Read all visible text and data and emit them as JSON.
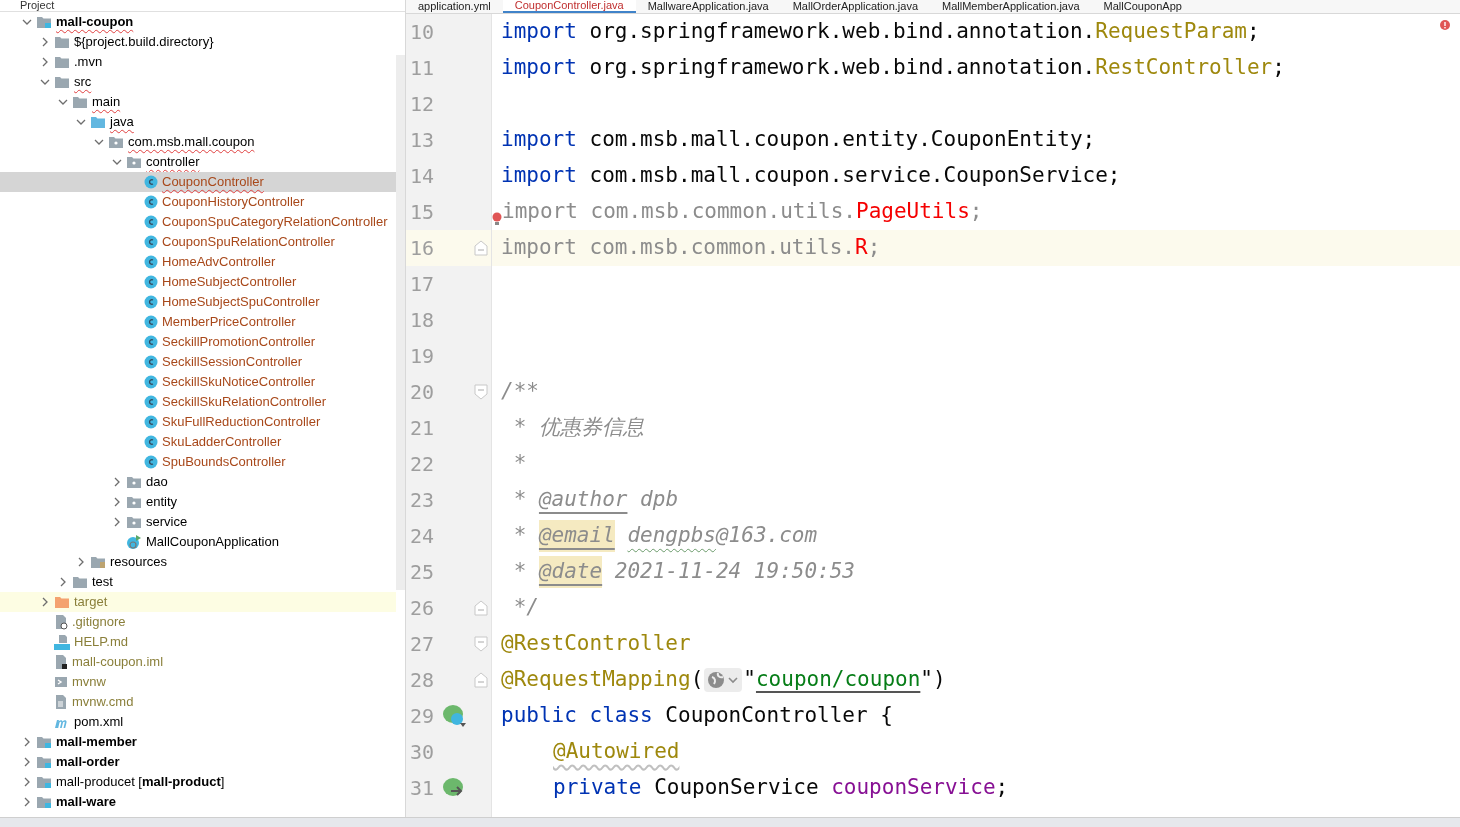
{
  "project_panel": {
    "title": "Project",
    "tree": [
      {
        "label": "mall-coupon",
        "kind": "module",
        "bold": true,
        "error": true,
        "expanded": true,
        "children": [
          {
            "label": "${project.build.directory}",
            "kind": "folder",
            "expanded": false
          },
          {
            "label": ".mvn",
            "kind": "folder",
            "expanded": false
          },
          {
            "label": "src",
            "kind": "folder",
            "error": true,
            "expanded": true,
            "children": [
              {
                "label": "main",
                "kind": "folder",
                "error": true,
                "expanded": true,
                "children": [
                  {
                    "label": "java",
                    "kind": "source-folder",
                    "error": true,
                    "expanded": true,
                    "children": [
                      {
                        "label": "com.msb.mall.coupon",
                        "kind": "package",
                        "error": true,
                        "expanded": true,
                        "children": [
                          {
                            "label": "controller",
                            "kind": "package",
                            "error": true,
                            "expanded": true,
                            "children": [
                              {
                                "label": "CouponController",
                                "kind": "class",
                                "color": "#a8481a",
                                "error": true,
                                "selected": true
                              },
                              {
                                "label": "CouponHistoryController",
                                "kind": "class",
                                "color": "#a8481a",
                                "selected": false
                              },
                              {
                                "label": "CouponSpuCategoryRelationController",
                                "kind": "class",
                                "color": "#a8481a",
                                "selected": false
                              },
                              {
                                "label": "CouponSpuRelationController",
                                "kind": "class",
                                "color": "#a8481a",
                                "selected": false
                              },
                              {
                                "label": "HomeAdvController",
                                "kind": "class",
                                "color": "#a8481a",
                                "selected": false
                              },
                              {
                                "label": "HomeSubjectController",
                                "kind": "class",
                                "color": "#a8481a",
                                "selected": false
                              },
                              {
                                "label": "HomeSubjectSpuController",
                                "kind": "class",
                                "color": "#a8481a",
                                "selected": false
                              },
                              {
                                "label": "MemberPriceController",
                                "kind": "class",
                                "color": "#a8481a",
                                "selected": false
                              },
                              {
                                "label": "SeckillPromotionController",
                                "kind": "class",
                                "color": "#a8481a",
                                "selected": false
                              },
                              {
                                "label": "SeckillSessionController",
                                "kind": "class",
                                "color": "#a8481a",
                                "selected": false
                              },
                              {
                                "label": "SeckillSkuNoticeController",
                                "kind": "class",
                                "color": "#a8481a",
                                "selected": false
                              },
                              {
                                "label": "SeckillSkuRelationController",
                                "kind": "class",
                                "color": "#a8481a",
                                "selected": false
                              },
                              {
                                "label": "SkuFullReductionController",
                                "kind": "class",
                                "color": "#a8481a",
                                "selected": false
                              },
                              {
                                "label": "SkuLadderController",
                                "kind": "class",
                                "color": "#a8481a",
                                "selected": false
                              },
                              {
                                "label": "SpuBoundsController",
                                "kind": "class",
                                "color": "#a8481a",
                                "selected": false
                              }
                            ]
                          },
                          {
                            "label": "dao",
                            "kind": "package",
                            "expanded": false
                          },
                          {
                            "label": "entity",
                            "kind": "package",
                            "expanded": false
                          },
                          {
                            "label": "service",
                            "kind": "package",
                            "expanded": false
                          },
                          {
                            "label": "MallCouponApplication",
                            "kind": "app-class"
                          }
                        ]
                      }
                    ]
                  },
                  {
                    "label": "resources",
                    "kind": "resources-folder",
                    "expanded": false
                  }
                ]
              },
              {
                "label": "test",
                "kind": "folder",
                "expanded": false
              }
            ]
          },
          {
            "label": "target",
            "kind": "excluded-folder",
            "color": "#8a7f3a",
            "expanded": false,
            "highlighted": true
          },
          {
            "label": ".gitignore",
            "kind": "ignore-file",
            "color": "#8a7f3a"
          },
          {
            "label": "HELP.md",
            "kind": "markdown-file",
            "color": "#8a7f3a"
          },
          {
            "label": "mall-coupon.iml",
            "kind": "module-file",
            "color": "#8a7f3a"
          },
          {
            "label": "mvnw",
            "kind": "shell-file",
            "color": "#8a7f3a"
          },
          {
            "label": "mvnw.cmd",
            "kind": "text-file",
            "color": "#8a7f3a"
          },
          {
            "label": "pom.xml",
            "kind": "maven-file"
          }
        ]
      },
      {
        "label": "mall-member",
        "kind": "module",
        "bold": true,
        "expanded": false
      },
      {
        "label": "mall-order",
        "kind": "module",
        "bold": true,
        "expanded": false
      },
      {
        "label": "mall-producet [**mall-product**]",
        "kind": "module",
        "expanded": false
      },
      {
        "label": "mall-ware",
        "kind": "module",
        "bold": true,
        "expanded": false
      }
    ]
  },
  "editor_tabs": [
    {
      "label": "application.yml",
      "selected": false
    },
    {
      "label": "CouponController.java",
      "selected": true
    },
    {
      "label": "MallwareApplication.java",
      "selected": false
    },
    {
      "label": "MallOrderApplication.java",
      "selected": false
    },
    {
      "label": "MallMemberApplication.java",
      "selected": false
    },
    {
      "label": "MallCouponApp",
      "selected": false
    }
  ],
  "code_lines": [
    {
      "number": "10",
      "tokens": [
        {
          "kind": "keyword",
          "text": "import"
        },
        {
          "kind": "plain",
          "text": " org.springframework.web.bind.annotation."
        },
        {
          "kind": "annotation",
          "text": "RequestParam"
        },
        {
          "kind": "plain",
          "text": ";"
        }
      ]
    },
    {
      "number": "11",
      "tokens": [
        {
          "kind": "keyword",
          "text": "import"
        },
        {
          "kind": "plain",
          "text": " org.springframework.web.bind.annotation."
        },
        {
          "kind": "annotation",
          "text": "RestController"
        },
        {
          "kind": "plain",
          "text": ";"
        }
      ]
    },
    {
      "number": "12"
    },
    {
      "number": "13",
      "tokens": [
        {
          "kind": "keyword",
          "text": "import"
        },
        {
          "kind": "plain",
          "text": " com.msb.mall.coupon.entity.CouponEntity;"
        }
      ]
    },
    {
      "number": "14",
      "tokens": [
        {
          "kind": "keyword",
          "text": "import"
        },
        {
          "kind": "plain",
          "text": " com.msb.mall.coupon.service.CouponService;"
        }
      ]
    },
    {
      "number": "15",
      "error_bulb": true,
      "tokens": [
        {
          "kind": "unused",
          "text": "import com.msb.common.utils."
        },
        {
          "kind": "error",
          "text": "PageUtils"
        },
        {
          "kind": "unused",
          "text": ";"
        }
      ]
    },
    {
      "number": "16",
      "current": true,
      "fold_open": false,
      "tokens": [
        {
          "kind": "unused",
          "text": "import com.msb.common.utils."
        },
        {
          "kind": "error",
          "text": "R"
        },
        {
          "kind": "unused",
          "text": ";"
        }
      ]
    },
    {
      "number": "17"
    },
    {
      "number": "18"
    },
    {
      "number": "19"
    },
    {
      "number": "20",
      "fold_open": true,
      "tokens": [
        {
          "kind": "comment",
          "text": "/**"
        }
      ]
    },
    {
      "number": "21",
      "tokens": [
        {
          "kind": "comment",
          "text": " * 优惠券信息"
        }
      ]
    },
    {
      "number": "22",
      "tokens": [
        {
          "kind": "comment",
          "text": " *"
        }
      ]
    },
    {
      "number": "23",
      "tokens": [
        {
          "kind": "comment",
          "text": " * "
        },
        {
          "kind": "doc-tag",
          "text": "@author"
        },
        {
          "kind": "comment",
          "text": " dpb"
        }
      ]
    },
    {
      "number": "24",
      "tokens": [
        {
          "kind": "comment",
          "text": " * "
        },
        {
          "kind": "doc-tag-highlight",
          "text": "@email"
        },
        {
          "kind": "comment-typo",
          "text": "dengpbs"
        },
        {
          "kind": "comment",
          "text": "@163.com"
        }
      ]
    },
    {
      "number": "25",
      "tokens": [
        {
          "kind": "comment",
          "text": " * "
        },
        {
          "kind": "doc-tag-highlight",
          "text": "@date"
        },
        {
          "kind": "comment",
          "text": " 2021-11-24 19:50:53"
        }
      ]
    },
    {
      "number": "26",
      "fold_open": false,
      "tokens": [
        {
          "kind": "comment",
          "text": " */"
        }
      ]
    },
    {
      "number": "27",
      "fold_open": true,
      "tokens": [
        {
          "kind": "annotation",
          "text": "@RestController"
        }
      ]
    },
    {
      "number": "28",
      "fold_open": false,
      "tokens": [
        {
          "kind": "annotation",
          "text": "@RequestMapping"
        },
        {
          "kind": "plain",
          "text": "("
        },
        {
          "kind": "globe-inlay"
        },
        {
          "kind": "plain",
          "text": "\""
        },
        {
          "kind": "string-link",
          "text": "coupon/coupon"
        },
        {
          "kind": "plain",
          "text": "\")"
        }
      ]
    },
    {
      "number": "29",
      "bean_injection": false,
      "tokens": [
        {
          "kind": "keyword",
          "text": "public class"
        },
        {
          "kind": "plain",
          "text": " CouponController {"
        }
      ]
    },
    {
      "number": "30",
      "indented": true,
      "tokens": [
        {
          "kind": "annotation-warn",
          "text": "@Autowired"
        }
      ]
    },
    {
      "number": "31",
      "indented": true,
      "bean_injection": true,
      "tokens": [
        {
          "kind": "keyword",
          "text": "private"
        },
        {
          "kind": "plain",
          "text": " CouponService "
        },
        {
          "kind": "field",
          "text": "couponService"
        },
        {
          "kind": "plain",
          "text": ";"
        }
      ]
    }
  ]
}
